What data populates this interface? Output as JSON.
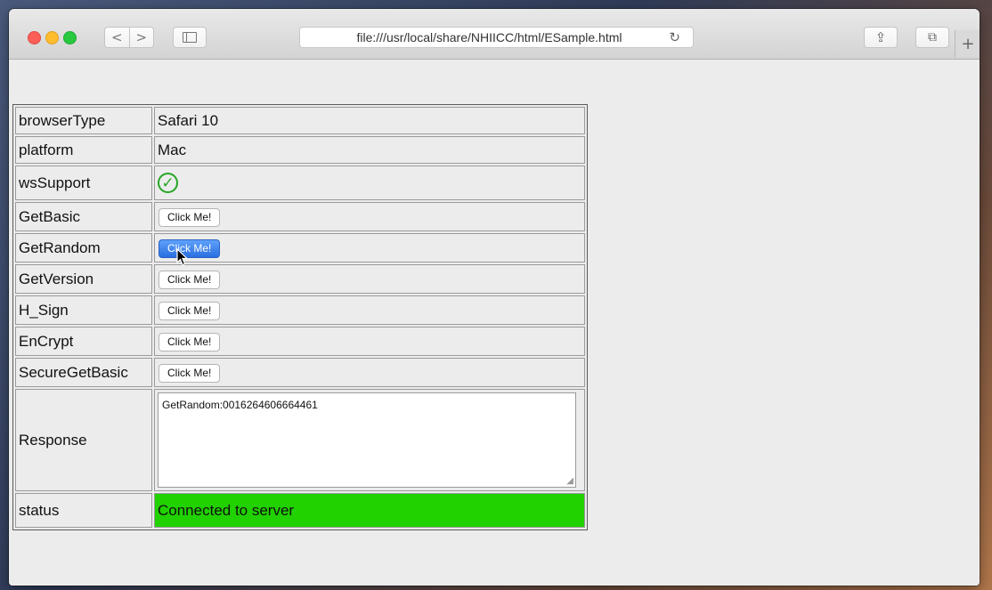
{
  "toolbar": {
    "back_label": "<",
    "forward_label": ">",
    "url": "file:///usr/local/share/NHIICC/html/ESample.html",
    "reload_glyph": "↻",
    "share_glyph": "⇪",
    "tabs_glyph": "⧉",
    "new_tab_glyph": "+"
  },
  "rows": [
    {
      "label": "browserType",
      "value": "Safari 10"
    },
    {
      "label": "platform",
      "value": "Mac"
    },
    {
      "label": "wsSupport",
      "value": "✓"
    },
    {
      "label": "GetBasic",
      "button": "Click Me!"
    },
    {
      "label": "GetRandom",
      "button": "Click Me!"
    },
    {
      "label": "GetVersion",
      "button": "Click Me!"
    },
    {
      "label": "H_Sign",
      "button": "Click Me!"
    },
    {
      "label": "EnCrypt",
      "button": "Click Me!"
    },
    {
      "label": "SecureGetBasic",
      "button": "Click Me!"
    },
    {
      "label": "Response",
      "value": "GetRandom:0016264606664461"
    },
    {
      "label": "status",
      "value": "Connected to server"
    }
  ],
  "colors": {
    "status_bg": "#21d100",
    "active_button": "#2a6fe0",
    "check": "#26a626"
  }
}
